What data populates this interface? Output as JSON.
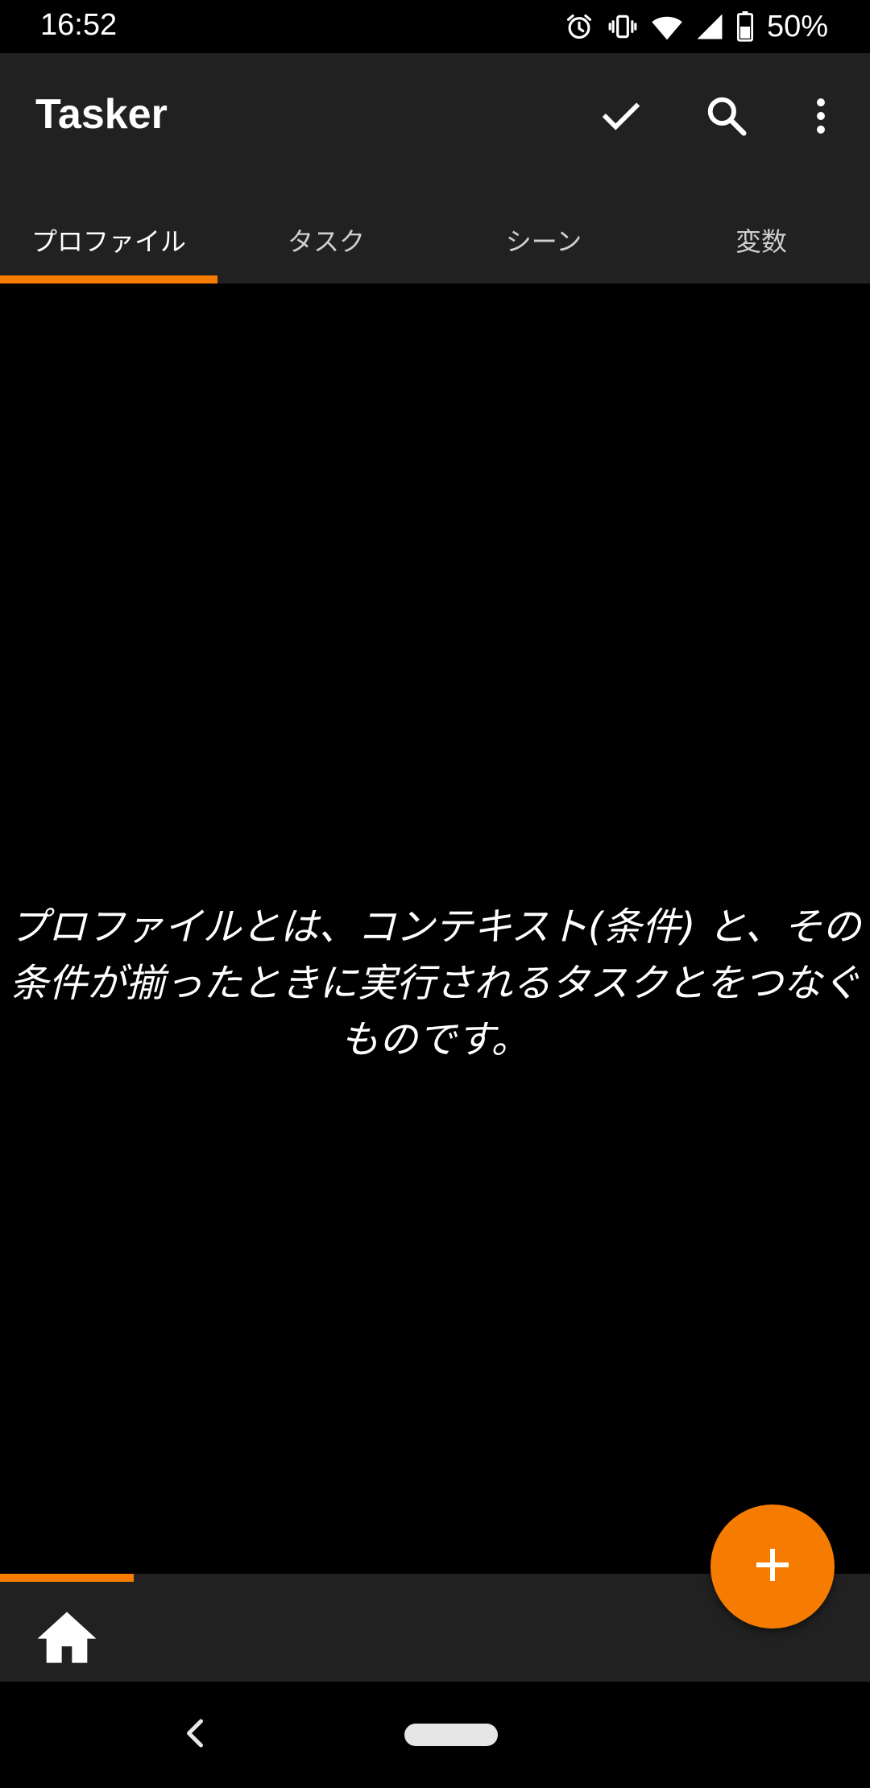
{
  "status_bar": {
    "time": "16:52",
    "battery_percent": "50%",
    "icons": [
      "alarm-icon",
      "vibrate-icon",
      "wifi-icon",
      "signal-icon",
      "battery-icon"
    ]
  },
  "app_bar": {
    "title": "Tasker",
    "actions": [
      "check-icon",
      "search-icon",
      "more-vert-icon"
    ]
  },
  "tabs": [
    {
      "label": "プロファイル",
      "active": true
    },
    {
      "label": "タスク",
      "active": false
    },
    {
      "label": "シーン",
      "active": false
    },
    {
      "label": "変数",
      "active": false
    }
  ],
  "main": {
    "empty_message": "プロファイルとは、コンテキスト(条件) と、その条件が揃ったときに実行されるタスクとをつなぐものです。"
  },
  "fab": {
    "icon": "plus-icon"
  },
  "bottom_bar": {
    "icon": "home-icon"
  },
  "nav_bar": {
    "back_icon": "back-icon",
    "home_pill": "home-pill"
  },
  "colors": {
    "accent": "#f57c00",
    "app_bar_bg": "#212121",
    "background": "#000000",
    "text": "#ffffff"
  }
}
